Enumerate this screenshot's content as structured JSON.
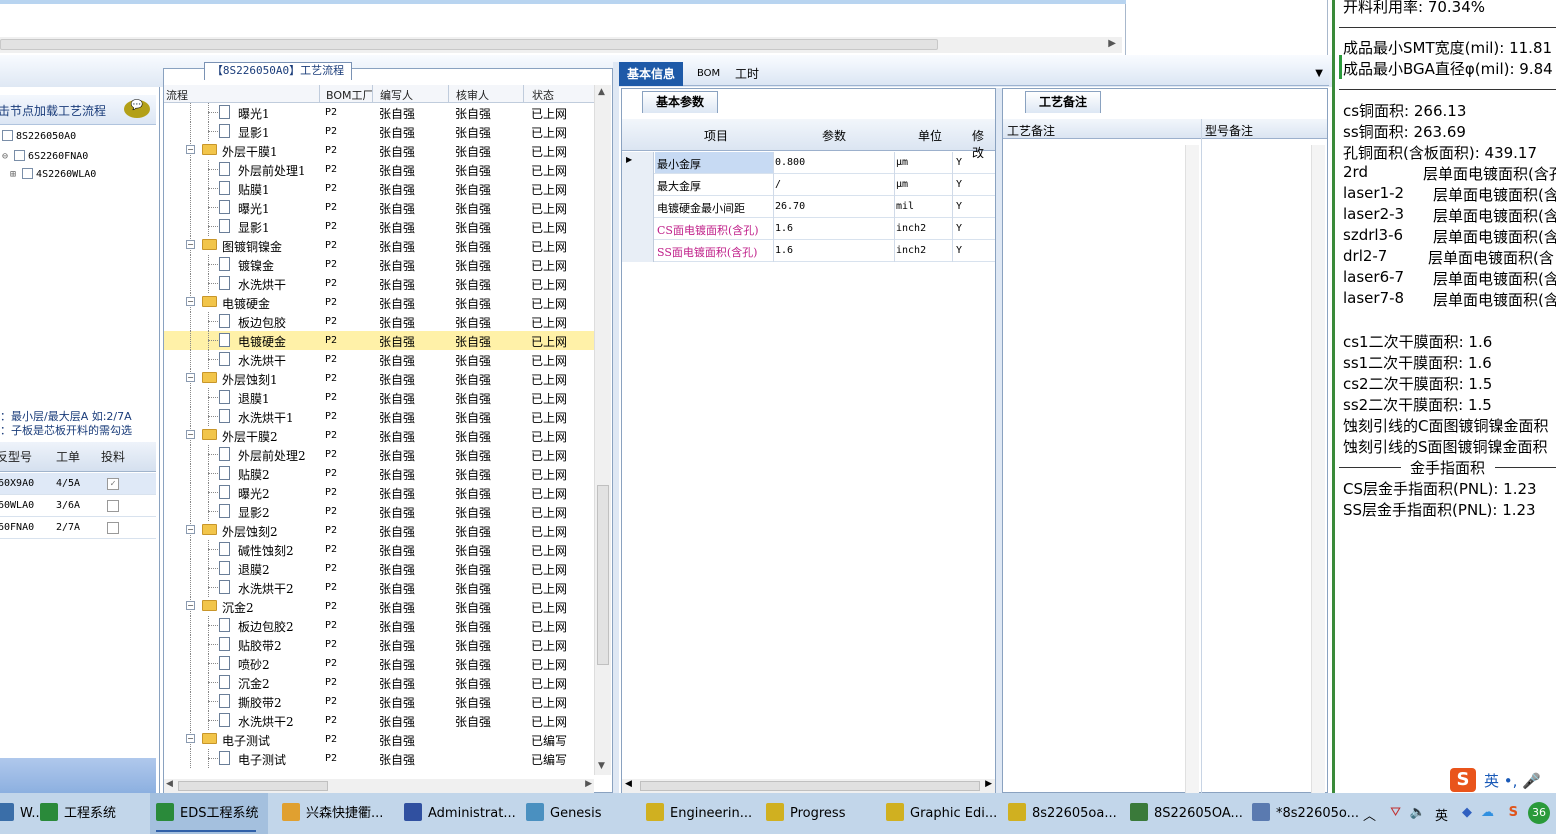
{
  "process_tab": "【8S226050A0】工艺流程",
  "left_panel": {
    "title": "击节点加载工艺流程",
    "tree": [
      "8S226050A0",
      "6S2260FNA0",
      "4S2260WLA0"
    ],
    "note1": "：最小层/最大层A 如:2/7A",
    "note2": "：子板是芯板开料的需勾选",
    "grid_headers": [
      "反型号",
      "工单",
      "投料"
    ],
    "grid_rows": [
      {
        "model": "60X9A0",
        "order": "4/5A",
        "checked": true
      },
      {
        "model": "60WLA0",
        "order": "3/6A",
        "checked": false
      },
      {
        "model": "60FNA0",
        "order": "2/7A",
        "checked": false
      }
    ]
  },
  "process_headers": [
    "流程",
    "BOM工厂",
    "编写人",
    "核审人",
    "状态"
  ],
  "process_rows": [
    {
      "name": "曝光1",
      "level": 2,
      "bom": "P2",
      "writer": "张自强",
      "checker": "张自强",
      "status": "已上网"
    },
    {
      "name": "显影1",
      "level": 2,
      "bom": "P2",
      "writer": "张自强",
      "checker": "张自强",
      "status": "已上网"
    },
    {
      "name": "外层干膜1",
      "level": 1,
      "bom": "P2",
      "writer": "张自强",
      "checker": "张自强",
      "status": "已上网"
    },
    {
      "name": "外层前处理1",
      "level": 2,
      "bom": "P2",
      "writer": "张自强",
      "checker": "张自强",
      "status": "已上网"
    },
    {
      "name": "贴膜1",
      "level": 2,
      "bom": "P2",
      "writer": "张自强",
      "checker": "张自强",
      "status": "已上网"
    },
    {
      "name": "曝光1",
      "level": 2,
      "bom": "P2",
      "writer": "张自强",
      "checker": "张自强",
      "status": "已上网"
    },
    {
      "name": "显影1",
      "level": 2,
      "bom": "P2",
      "writer": "张自强",
      "checker": "张自强",
      "status": "已上网"
    },
    {
      "name": "图镀铜镍金",
      "level": 1,
      "bom": "P2",
      "writer": "张自强",
      "checker": "张自强",
      "status": "已上网"
    },
    {
      "name": "镀镍金",
      "level": 2,
      "bom": "P2",
      "writer": "张自强",
      "checker": "张自强",
      "status": "已上网"
    },
    {
      "name": "水洗烘干",
      "level": 2,
      "bom": "P2",
      "writer": "张自强",
      "checker": "张自强",
      "status": "已上网"
    },
    {
      "name": "电镀硬金",
      "level": 1,
      "bom": "P2",
      "writer": "张自强",
      "checker": "张自强",
      "status": "已上网"
    },
    {
      "name": "板边包胶",
      "level": 2,
      "bom": "P2",
      "writer": "张自强",
      "checker": "张自强",
      "status": "已上网"
    },
    {
      "name": "电镀硬金",
      "level": 2,
      "bom": "P2",
      "writer": "张自强",
      "checker": "张自强",
      "status": "已上网",
      "selected": true
    },
    {
      "name": "水洗烘干",
      "level": 2,
      "bom": "P2",
      "writer": "张自强",
      "checker": "张自强",
      "status": "已上网"
    },
    {
      "name": "外层蚀刻1",
      "level": 1,
      "bom": "P2",
      "writer": "张自强",
      "checker": "张自强",
      "status": "已上网"
    },
    {
      "name": "退膜1",
      "level": 2,
      "bom": "P2",
      "writer": "张自强",
      "checker": "张自强",
      "status": "已上网"
    },
    {
      "name": "水洗烘干1",
      "level": 2,
      "bom": "P2",
      "writer": "张自强",
      "checker": "张自强",
      "status": "已上网"
    },
    {
      "name": "外层干膜2",
      "level": 1,
      "bom": "P2",
      "writer": "张自强",
      "checker": "张自强",
      "status": "已上网"
    },
    {
      "name": "外层前处理2",
      "level": 2,
      "bom": "P2",
      "writer": "张自强",
      "checker": "张自强",
      "status": "已上网"
    },
    {
      "name": "贴膜2",
      "level": 2,
      "bom": "P2",
      "writer": "张自强",
      "checker": "张自强",
      "status": "已上网"
    },
    {
      "name": "曝光2",
      "level": 2,
      "bom": "P2",
      "writer": "张自强",
      "checker": "张自强",
      "status": "已上网"
    },
    {
      "name": "显影2",
      "level": 2,
      "bom": "P2",
      "writer": "张自强",
      "checker": "张自强",
      "status": "已上网"
    },
    {
      "name": "外层蚀刻2",
      "level": 1,
      "bom": "P2",
      "writer": "张自强",
      "checker": "张自强",
      "status": "已上网"
    },
    {
      "name": "碱性蚀刻2",
      "level": 2,
      "bom": "P2",
      "writer": "张自强",
      "checker": "张自强",
      "status": "已上网"
    },
    {
      "name": "退膜2",
      "level": 2,
      "bom": "P2",
      "writer": "张自强",
      "checker": "张自强",
      "status": "已上网"
    },
    {
      "name": "水洗烘干2",
      "level": 2,
      "bom": "P2",
      "writer": "张自强",
      "checker": "张自强",
      "status": "已上网"
    },
    {
      "name": "沉金2",
      "level": 1,
      "bom": "P2",
      "writer": "张自强",
      "checker": "张自强",
      "status": "已上网"
    },
    {
      "name": "板边包胶2",
      "level": 2,
      "bom": "P2",
      "writer": "张自强",
      "checker": "张自强",
      "status": "已上网"
    },
    {
      "name": "贴胶带2",
      "level": 2,
      "bom": "P2",
      "writer": "张自强",
      "checker": "张自强",
      "status": "已上网"
    },
    {
      "name": "喷砂2",
      "level": 2,
      "bom": "P2",
      "writer": "张自强",
      "checker": "张自强",
      "status": "已上网"
    },
    {
      "name": "沉金2",
      "level": 2,
      "bom": "P2",
      "writer": "张自强",
      "checker": "张自强",
      "status": "已上网"
    },
    {
      "name": "撕胶带2",
      "level": 2,
      "bom": "P2",
      "writer": "张自强",
      "checker": "张自强",
      "status": "已上网"
    },
    {
      "name": "水洗烘干2",
      "level": 2,
      "bom": "P2",
      "writer": "张自强",
      "checker": "张自强",
      "status": "已上网"
    },
    {
      "name": "电子测试",
      "level": 1,
      "bom": "P2",
      "writer": "张自强",
      "checker": "",
      "status": "已编写"
    },
    {
      "name": "电子测试",
      "level": 2,
      "bom": "P2",
      "writer": "张自强",
      "checker": "",
      "status": "已编写"
    }
  ],
  "center_tabs": [
    "基本信息",
    "BOM",
    "工时"
  ],
  "basic_subtab": "基本参数",
  "basic_headers": [
    "项目",
    "参数",
    "单位",
    "修改"
  ],
  "basic_rows": [
    {
      "item": "最小金厚",
      "value": "0.800",
      "unit": "μm",
      "mod": "Y",
      "highlight": true,
      "pink": false
    },
    {
      "item": "最大金厚",
      "value": "/",
      "unit": "μm",
      "mod": "Y",
      "highlight": false,
      "pink": false
    },
    {
      "item": "电镀硬金最小间距",
      "value": "26.70",
      "unit": "mil",
      "mod": "Y",
      "highlight": false,
      "pink": false
    },
    {
      "item": "CS面电镀面积(含孔)",
      "value": "1.6",
      "unit": "inch2",
      "mod": "Y",
      "highlight": false,
      "pink": true
    },
    {
      "item": "SS面电镀面积(含孔)",
      "value": "1.6",
      "unit": "inch2",
      "mod": "Y",
      "highlight": false,
      "pink": true
    }
  ],
  "notes_subtab": "工艺备注",
  "notes_headers": [
    "工艺备注",
    "型号备注"
  ],
  "right_info": {
    "l0": "开料利用率: 70.34%",
    "l1": "成品最小SMT宽度(mil): 11.81",
    "l2": "成品最小BGA直径φ(mil):  9.84",
    "l3": "cs铜面积: 266.13",
    "l4": "ss铜面积: 263.69",
    "l5": "孔铜面积(含板面积): 439.17",
    "l6a": "2rd",
    "l6b": "层单面电镀面积(含孔",
    "l7a": "laser1-2",
    "l7b": "层单面电镀面积(含",
    "l8a": "laser2-3",
    "l8b": "层单面电镀面积(含",
    "l9a": "szdrl3-6",
    "l9b": "层单面电镀面积(含",
    "l10a": "drl2-7",
    "l10b": "层单面电镀面积(含",
    "l11a": "laser6-7",
    "l11b": "层单面电镀面积(含",
    "l12a": "laser7-8",
    "l12b": "层单面电镀面积(含",
    "l13": "cs1二次干膜面积: 1.6",
    "l14": "ss1二次干膜面积: 1.6",
    "l15": "cs2二次干膜面积: 1.5",
    "l16": "ss2二次干膜面积: 1.5",
    "l17": "蚀刻引线的C面图镀铜镍金面积",
    "l18": "蚀刻引线的S面图镀铜镍金面积",
    "l19": "金手指面积",
    "l20": "CS层金手指面积(PNL): 1.23",
    "l21": "SS层金手指面积(PNL): 1.23"
  },
  "ime": {
    "logo": "S",
    "text": "英 •, 🎤"
  },
  "taskbar": [
    {
      "label": "W...",
      "color": "#3a6ea8"
    },
    {
      "label": "工程系统",
      "color": "#2a8a3a"
    },
    {
      "label": "EDS工程系统",
      "color": "#2a8a3a"
    },
    {
      "label": "兴森快捷衢...",
      "color": "#e0a030"
    },
    {
      "label": "Administrat...",
      "color": "#3050a0"
    },
    {
      "label": "Genesis",
      "color": "#4a90c0"
    },
    {
      "label": "Engineerin...",
      "color": "#d0b020"
    },
    {
      "label": "Progress",
      "color": "#d0b020"
    },
    {
      "label": "Graphic Edi...",
      "color": "#d0b020"
    },
    {
      "label": "8s22605oa...",
      "color": "#d0b020"
    },
    {
      "label": "8S22605OA...",
      "color": "#3a7a3a"
    },
    {
      "label": "*8s22605o...",
      "color": "#5a7ab0"
    }
  ],
  "tray": {
    "ime": "英",
    "badge": "36"
  }
}
